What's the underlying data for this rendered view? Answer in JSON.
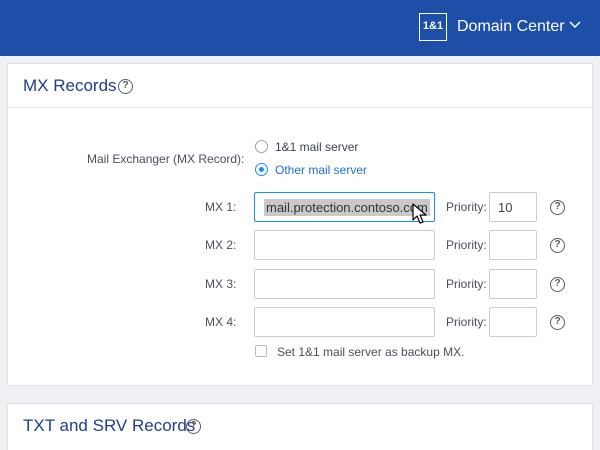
{
  "header": {
    "logo_text": "1&1",
    "app_title": "Domain Center",
    "background_color": "#1d4ea8"
  },
  "mx_section": {
    "title": "MX Records",
    "mail_exchanger_label": "Mail Exchanger (MX Record):",
    "options": [
      {
        "label": "1&1 mail server",
        "selected": false
      },
      {
        "label": "Other mail server",
        "selected": true
      }
    ],
    "rows": [
      {
        "label": "MX 1:",
        "value": "mail.protection.contoso.com",
        "priority_label": "Priority:",
        "priority": "10"
      },
      {
        "label": "MX 2:",
        "value": "",
        "priority_label": "Priority:",
        "priority": ""
      },
      {
        "label": "MX 3:",
        "value": "",
        "priority_label": "Priority:",
        "priority": ""
      },
      {
        "label": "MX 4:",
        "value": "",
        "priority_label": "Priority:",
        "priority": ""
      }
    ],
    "backup_label": "Set 1&1 mail server as backup MX.",
    "backup_checked": false
  },
  "txt_section": {
    "title": "TXT and SRV Records"
  },
  "accent_color": "#1a8cff"
}
